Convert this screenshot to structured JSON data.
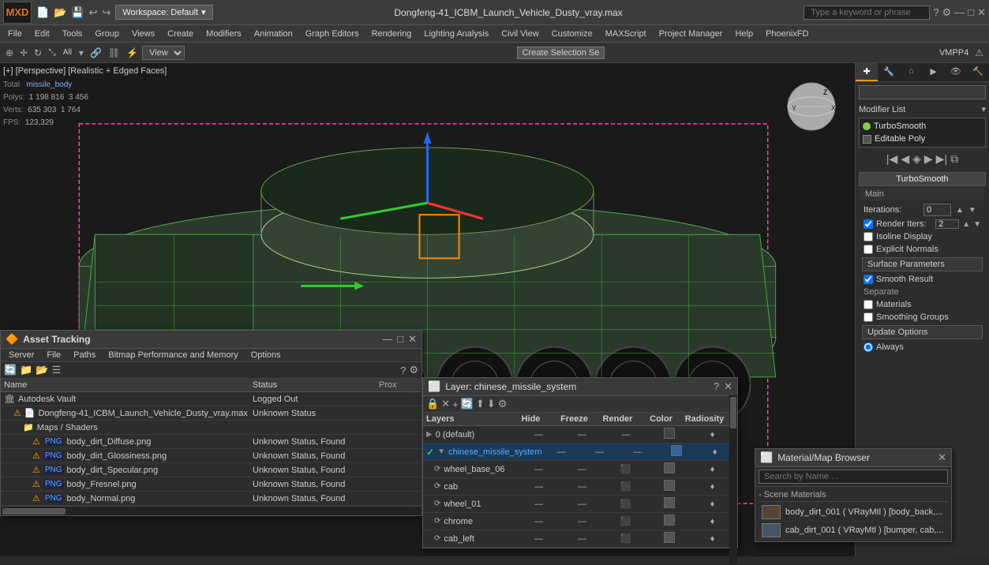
{
  "topbar": {
    "logo": "MXD",
    "title": "Dongfeng-41_ICBM_Launch_Vehicle_Dusty_vray.max",
    "workspace_label": "Workspace: Default",
    "search_placeholder": "Type a keyword or phrase"
  },
  "menubar": {
    "items": [
      "File",
      "Edit",
      "Tools",
      "Group",
      "Views",
      "Create",
      "Modifiers",
      "Animation",
      "Graph Editors",
      "Rendering",
      "Lighting Analysis",
      "Civil View",
      "Customize",
      "MAXScript",
      "Project Manager",
      "Help",
      "PhoenixFD"
    ]
  },
  "toolbar2": {
    "view_label": "View",
    "create_sel_label": "Create Selection Se",
    "vmpp4_label": "VMPP4"
  },
  "viewport": {
    "label": "[+] [Perspective] [Realistic + Edged Faces]",
    "stats": {
      "total_label": "Total",
      "obj_name": "missile_body",
      "polys_label": "Polys:",
      "polys_val": "1 198 816",
      "polys_val2": "3 456",
      "verts_label": "Verts:",
      "verts_val": "635 303",
      "verts_val2": "1 764",
      "fps_label": "FPS:",
      "fps_val": "123,329"
    }
  },
  "right_panel": {
    "object_name": "missile_body",
    "modifier_list_label": "Modifier List",
    "modifiers": [
      {
        "name": "TurboSmooth",
        "active": true,
        "light_on": true
      },
      {
        "name": "Editable Poly",
        "active": true,
        "light_on": false
      }
    ],
    "icon_labels": [
      "go-to-first",
      "prev",
      "highlight",
      "next",
      "go-to-last",
      "copy"
    ],
    "turbosmooth": {
      "title": "TurboSmooth",
      "main_label": "Main",
      "iterations_label": "Iterations:",
      "iterations_val": "0",
      "render_iters_label": "Render Iters:",
      "render_iters_val": "2",
      "render_iters_checked": true,
      "isoline_display_label": "Isoline Display",
      "explicit_normals_label": "Explicit Normals",
      "surface_params_label": "Surface Parameters",
      "smooth_result_label": "Smooth Result",
      "smooth_result_checked": true,
      "separate_label": "Separate",
      "materials_label": "Materials",
      "smoothing_groups_label": "Smoothing Groups",
      "update_opts_label": "Update Options",
      "always_label": "Always"
    }
  },
  "asset_tracking": {
    "title": "Asset Tracking",
    "menu_items": [
      "Server",
      "File",
      "Paths",
      "Bitmap Performance and Memory",
      "Options"
    ],
    "table_headers": [
      "Name",
      "Status",
      "Prox"
    ],
    "rows": [
      {
        "indent": 0,
        "type": "vault",
        "name": "Autodesk Vault",
        "status": "Logged Out",
        "prox": ""
      },
      {
        "indent": 1,
        "type": "file",
        "name": "Dongfeng-41_ICBM_Launch_Vehicle_Dusty_vray.max",
        "status": "Unknown Status",
        "prox": ""
      },
      {
        "indent": 2,
        "type": "folder",
        "name": "Maps / Shaders",
        "status": "",
        "prox": ""
      },
      {
        "indent": 3,
        "type": "png",
        "name": "body_dirt_Diffuse.png",
        "status": "Unknown Status, Found",
        "prox": ""
      },
      {
        "indent": 3,
        "type": "png",
        "name": "body_dirt_Glossiness.png",
        "status": "Unknown Status, Found",
        "prox": ""
      },
      {
        "indent": 3,
        "type": "png",
        "name": "body_dirt_Specular.png",
        "status": "Unknown Status, Found",
        "prox": ""
      },
      {
        "indent": 3,
        "type": "png",
        "name": "body_Fresnel.png",
        "status": "Unknown Status, Found",
        "prox": ""
      },
      {
        "indent": 3,
        "type": "png",
        "name": "body_Normal.png",
        "status": "Unknown Status, Found",
        "prox": ""
      }
    ]
  },
  "layer_window": {
    "title": "Layer: chinese_missile_system",
    "col_headers": [
      "Layers",
      "Hide",
      "Freeze",
      "Render",
      "Color",
      "Radiosity"
    ],
    "rows": [
      {
        "indent": 0,
        "name": "0 (default)",
        "hide": "—",
        "freeze": "—",
        "render": "—",
        "color": "#888",
        "radiosity": "♦",
        "checked": false
      },
      {
        "indent": 0,
        "name": "chinese_missile_system",
        "hide": "—",
        "freeze": "—",
        "render": "—",
        "color": "#336699",
        "radiosity": "♦",
        "checked": true,
        "selected": true
      },
      {
        "indent": 1,
        "name": "wheel_base_06",
        "hide": "—",
        "freeze": "—",
        "render": "⬛",
        "color": "#333",
        "radiosity": "♦",
        "checked": false
      },
      {
        "indent": 1,
        "name": "cab",
        "hide": "—",
        "freeze": "—",
        "render": "⬛",
        "color": "#333",
        "radiosity": "♦",
        "checked": false
      },
      {
        "indent": 1,
        "name": "wheel_01",
        "hide": "—",
        "freeze": "—",
        "render": "⬛",
        "color": "#333",
        "radiosity": "♦",
        "checked": false
      },
      {
        "indent": 1,
        "name": "chrome",
        "hide": "—",
        "freeze": "—",
        "render": "⬛",
        "color": "#333",
        "radiosity": "♦",
        "checked": false
      },
      {
        "indent": 1,
        "name": "cab_left",
        "hide": "—",
        "freeze": "—",
        "render": "⬛",
        "color": "#333",
        "radiosity": "♦",
        "checked": false
      }
    ]
  },
  "material_browser": {
    "title": "Material/Map Browser",
    "search_placeholder": "Search by Name ...",
    "section_title": "- Scene Materials",
    "items": [
      {
        "name": "body_dirt_001 ( VRayMtl ) [body_back,..."
      },
      {
        "name": "cab_dirt_001 ( VRayMtl ) [bumper, cab,..."
      }
    ]
  }
}
